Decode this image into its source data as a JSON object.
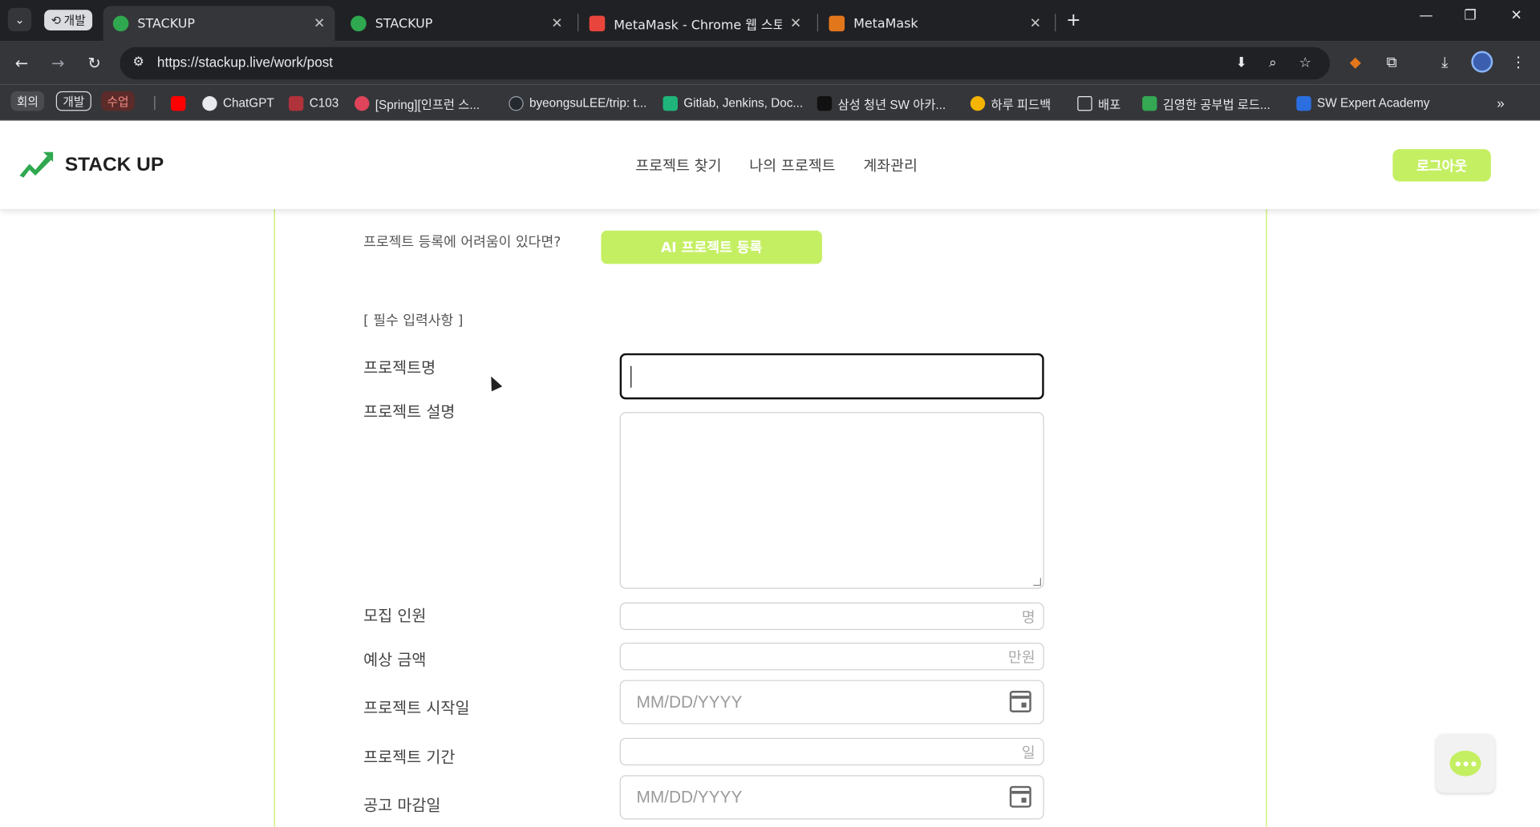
{
  "browser": {
    "tab_group": "개발",
    "tabs": [
      {
        "title": "STACKUP",
        "active": true
      },
      {
        "title": "STACKUP",
        "active": false
      },
      {
        "title": "MetaMask - Chrome 웹 스토어",
        "active": false
      },
      {
        "title": "MetaMask",
        "active": false
      }
    ],
    "url": "https://stackup.live/work/post",
    "bookmark_chips": [
      "회의",
      "개발",
      "수업"
    ],
    "bookmarks": [
      "ChatGPT",
      "C103",
      "[Spring][인프런 스...",
      "byeongsuLEE/trip: t...",
      "Gitlab, Jenkins, Doc...",
      "삼성 청년 SW 아카...",
      "하루 피드백",
      "배포",
      "김영한 공부법 로드...",
      "SW Expert Academy"
    ]
  },
  "site": {
    "logo": "STACK UP",
    "nav": [
      "프로젝트 찾기",
      "나의 프로젝트",
      "계좌관리"
    ],
    "logout": "로그아웃"
  },
  "form": {
    "help_text": "프로젝트 등록에 어려움이 있다면?",
    "ai_button": "AI 프로젝트 등록",
    "required_label": "[ 필수 입력사항 ]",
    "fields": {
      "name_label": "프로젝트명",
      "desc_label": "프로젝트 설명",
      "recruit_label": "모집 인원",
      "recruit_suffix": "명",
      "amount_label": "예상 금액",
      "amount_suffix": "만원",
      "start_label": "프로젝트 시작일",
      "start_placeholder": "MM/DD/YYYY",
      "period_label": "프로젝트 기간",
      "period_suffix": "일",
      "deadline_label": "공고 마감일",
      "deadline_placeholder": "MM/DD/YYYY"
    }
  },
  "colors": {
    "accent": "#c5ef63",
    "browser_dark": "#202124",
    "browser_toolbar": "#35363a"
  }
}
